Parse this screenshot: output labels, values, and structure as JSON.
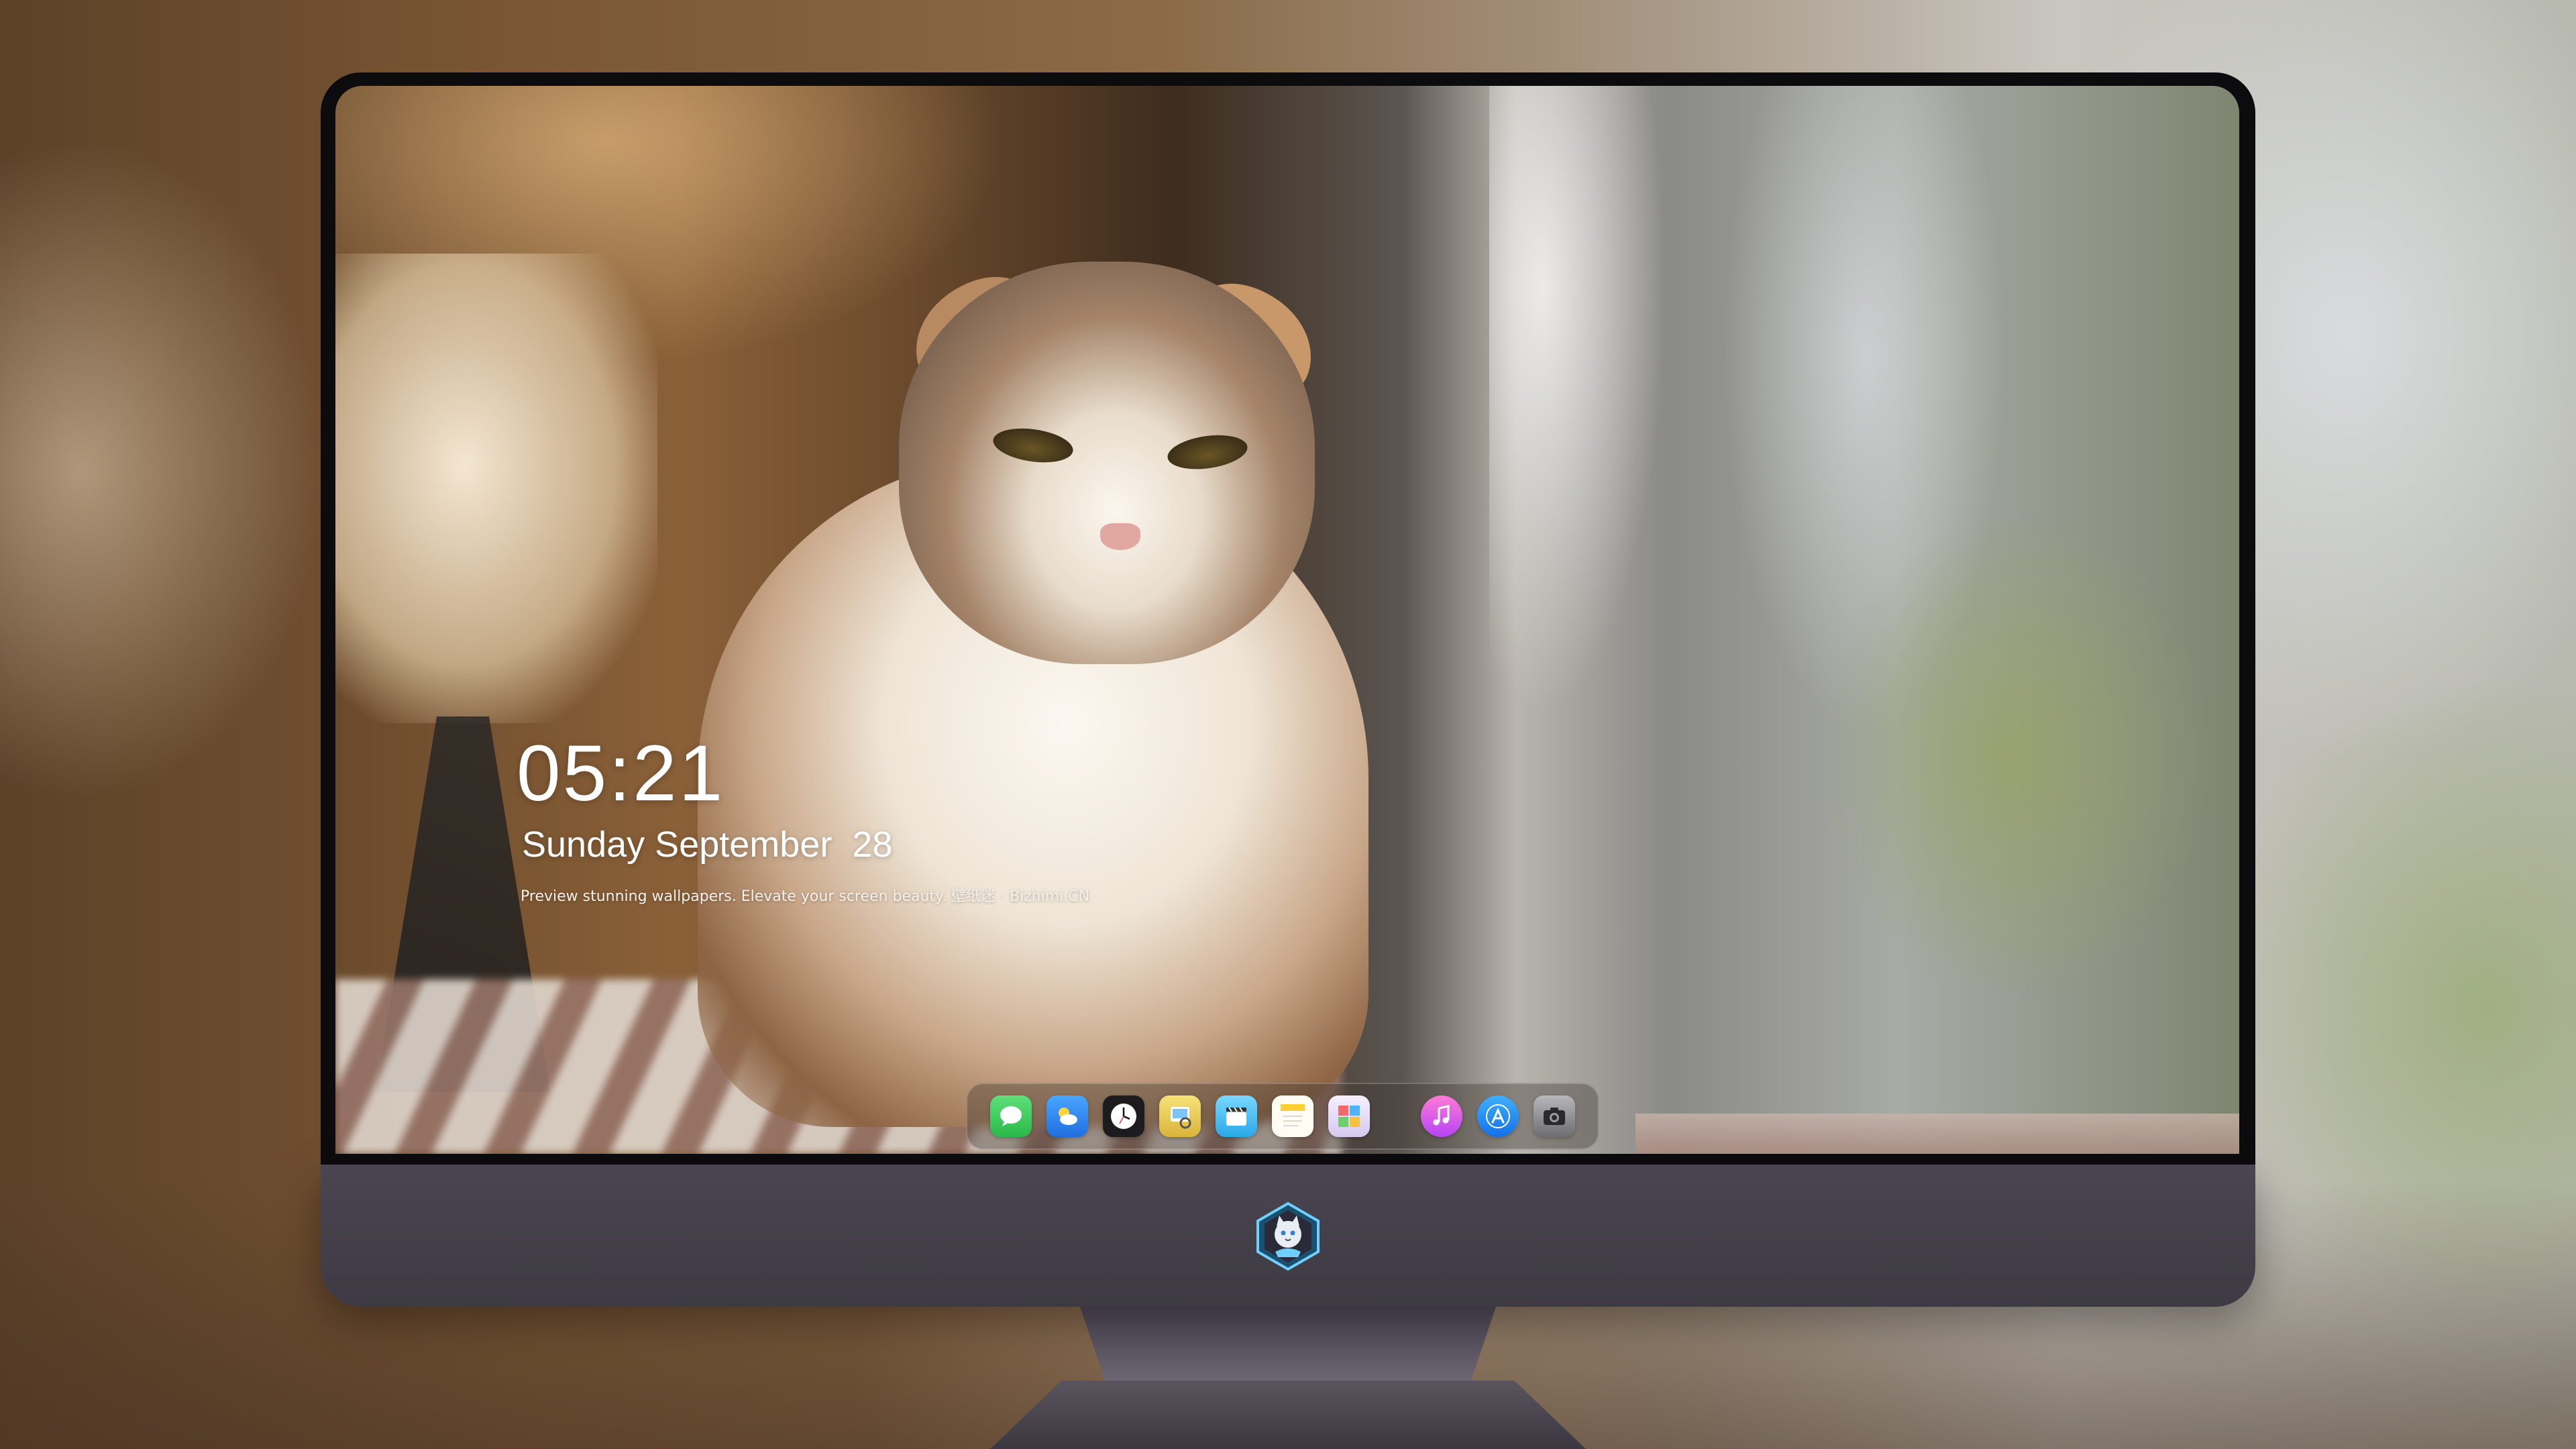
{
  "lock_screen": {
    "time": "05:21",
    "date": "Sunday September  28",
    "caption": "Preview stunning wallpapers. Elevate your screen beauty. 壁纸迷 · Bizhimi.CN"
  },
  "dock": {
    "apps": [
      {
        "name": "Messages",
        "icon": "messages-icon",
        "color": "#34c759"
      },
      {
        "name": "Weather",
        "icon": "weather-icon",
        "color": "#2f8cf5"
      },
      {
        "name": "Clock",
        "icon": "clock-icon",
        "color": "#1c1c1e"
      },
      {
        "name": "Preview",
        "icon": "preview-icon",
        "color": "#e9c84a"
      },
      {
        "name": "Clips",
        "icon": "clips-icon",
        "color": "#5ac8fa"
      },
      {
        "name": "Notes",
        "icon": "notes-icon",
        "color": "#ffd54a"
      },
      {
        "name": "Photo Booth",
        "icon": "photo-booth-icon",
        "color": "#c9a5e6"
      },
      {
        "name": "Music",
        "icon": "music-icon",
        "color": "#ea4cc0"
      },
      {
        "name": "App Store",
        "icon": "app-store-icon",
        "color": "#1a8ff0"
      },
      {
        "name": "Camera",
        "icon": "camera-icon",
        "color": "#8e8e93"
      }
    ]
  },
  "monitor": {
    "logo": "cat-mascot-logo",
    "chin_color": "#45404b"
  }
}
